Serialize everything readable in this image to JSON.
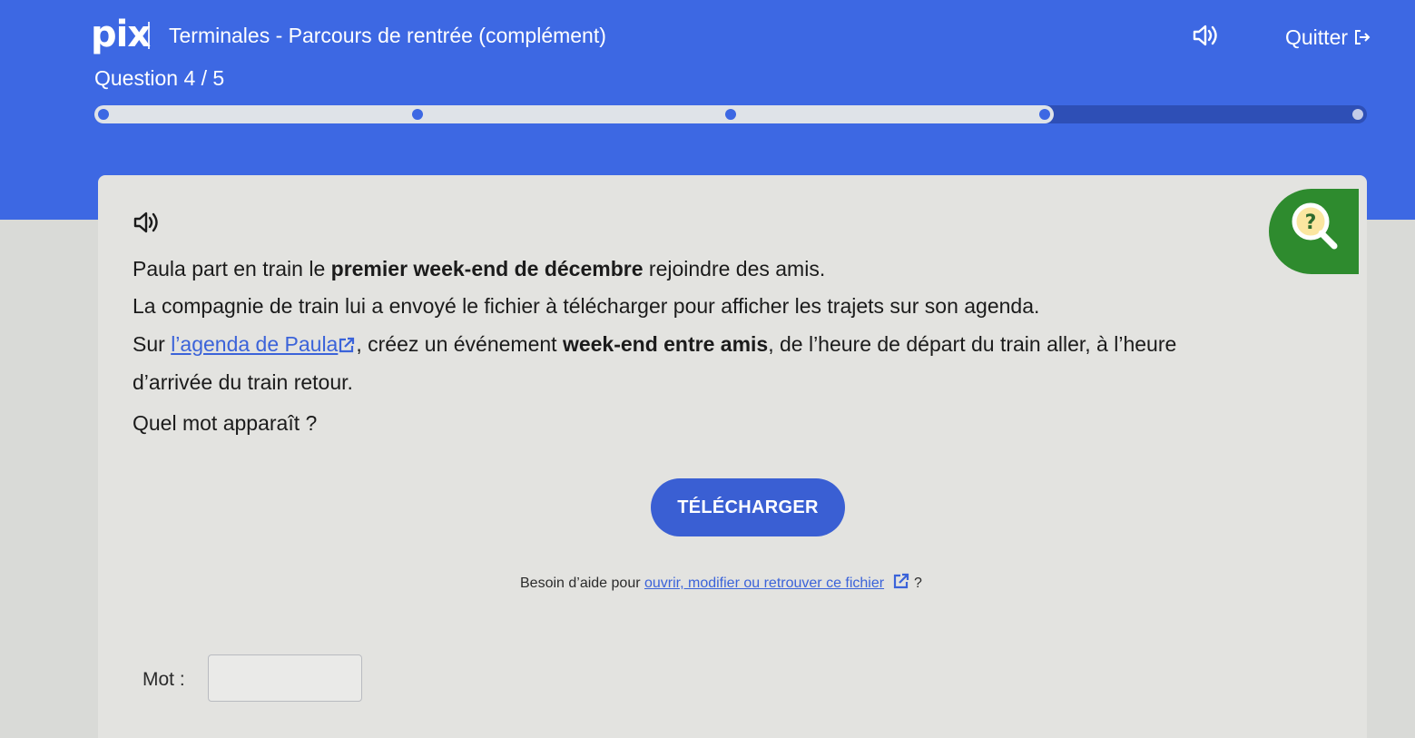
{
  "header": {
    "logo": "pix",
    "course_title": "Terminales - Parcours de rentrée (complément)",
    "quit_label": "Quitter",
    "question_counter": "Question 4 / 5"
  },
  "progress": {
    "current_step": 4,
    "total_steps": 5
  },
  "challenge": {
    "line1_before": "Paula part en train le ",
    "line1_bold": "premier week-end de décembre",
    "line1_after": " rejoindre des amis.",
    "line2": "La compagnie de train lui a envoyé le fichier à télécharger pour afficher les trajets sur son agenda.",
    "line3_before": "Sur ",
    "line3_link": "l’agenda de Paula",
    "line3_middle": ", créez un événement ",
    "line3_bold": "week-end entre amis",
    "line3_after": ", de l’heure de départ du train aller, à l’heure",
    "line4": "d’arrivée du train retour.",
    "question": "Quel mot apparaît ?",
    "download_label": "TÉLÉCHARGER",
    "help_before": "Besoin d’aide pour ",
    "help_link": "ouvrir, modifier ou retrouver ce fichier",
    "help_after": " ?",
    "answer_label": "Mot :",
    "answer_value": ""
  },
  "colors": {
    "header_bg": "#3d68e3",
    "card_bg": "#e3e3e0",
    "button_bg": "#3a5fd3",
    "tuto_badge": "#2e8b2e",
    "link": "#3b63d9"
  },
  "icons": {
    "sound": "speaker-icon",
    "quit": "exit-icon",
    "tutorial": "magnifier-question-icon",
    "external_link": "external-link-icon"
  }
}
